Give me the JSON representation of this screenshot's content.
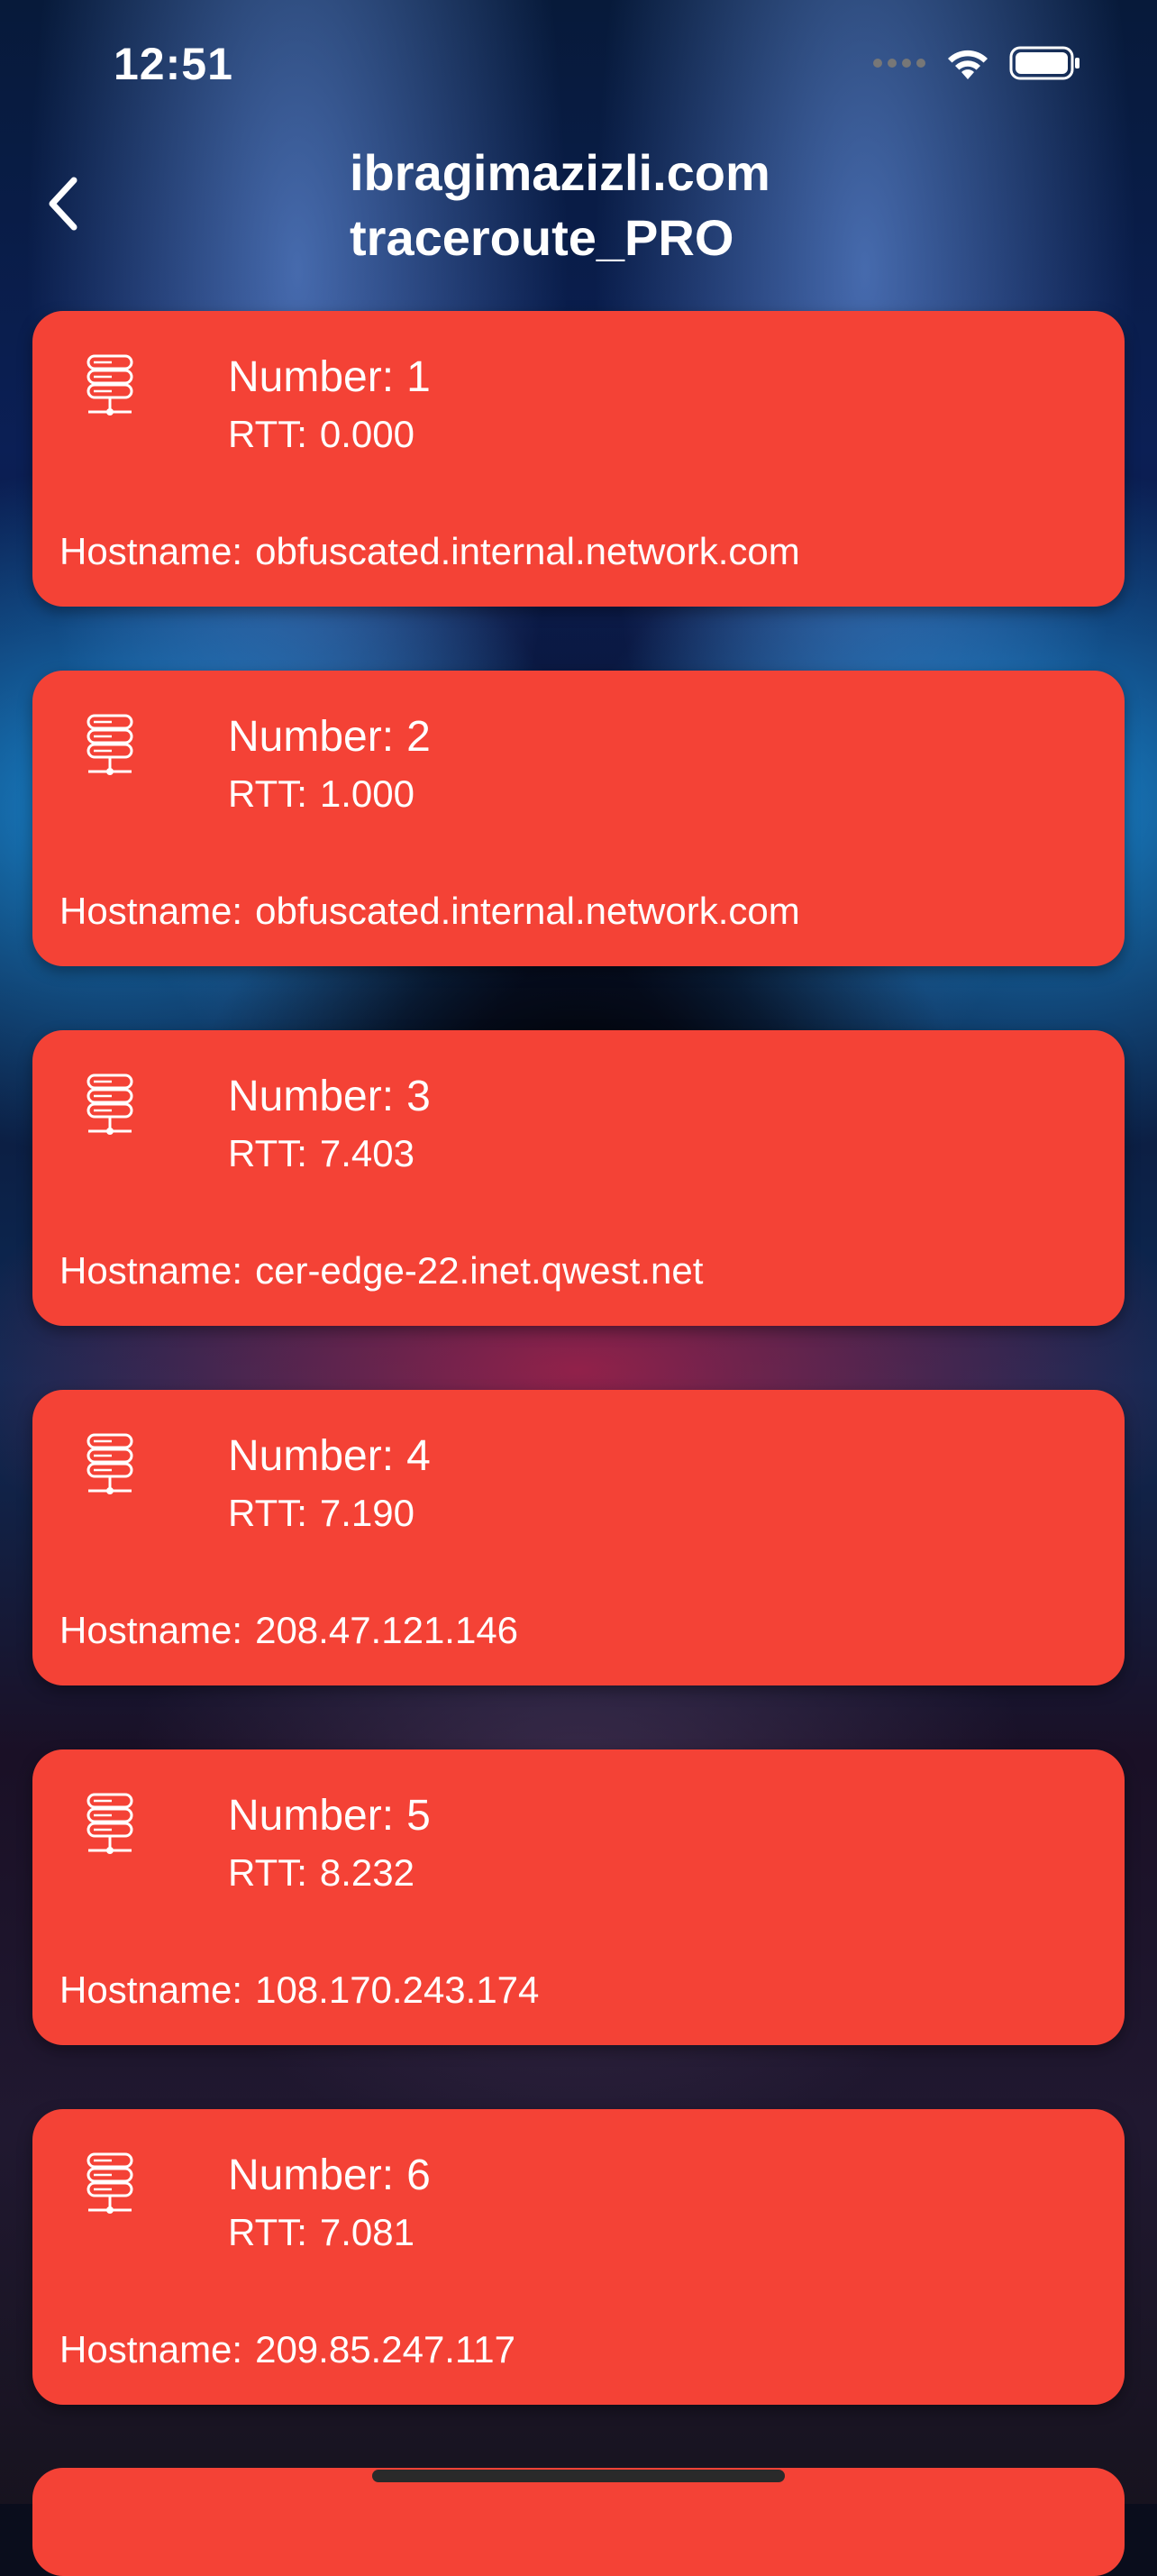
{
  "status_bar": {
    "time": "12:51",
    "icons": [
      "signal-dots-icon",
      "wifi-icon",
      "battery-icon"
    ]
  },
  "nav": {
    "back_icon": "chevron-left-icon",
    "title_line1": "ibragimazizli.com",
    "title_line2": "traceroute_PRO"
  },
  "labels": {
    "number": "Number:",
    "rtt": "RTT:",
    "hostname": "Hostname:"
  },
  "hops": [
    {
      "icon": "server-icon",
      "number": "1",
      "rtt": "0.000",
      "hostname": "obfuscated.internal.network.com"
    },
    {
      "icon": "server-icon",
      "number": "2",
      "rtt": "1.000",
      "hostname": "obfuscated.internal.network.com"
    },
    {
      "icon": "server-icon",
      "number": "3",
      "rtt": "7.403",
      "hostname": "cer-edge-22.inet.qwest.net"
    },
    {
      "icon": "server-icon",
      "number": "4",
      "rtt": "7.190",
      "hostname": "208.47.121.146"
    },
    {
      "icon": "server-icon",
      "number": "5",
      "rtt": "8.232",
      "hostname": "108.170.243.174"
    },
    {
      "icon": "server-icon",
      "number": "6",
      "rtt": "7.081",
      "hostname": "209.85.247.117"
    }
  ],
  "colors": {
    "card": "#f44236",
    "text": "#ffffff"
  }
}
